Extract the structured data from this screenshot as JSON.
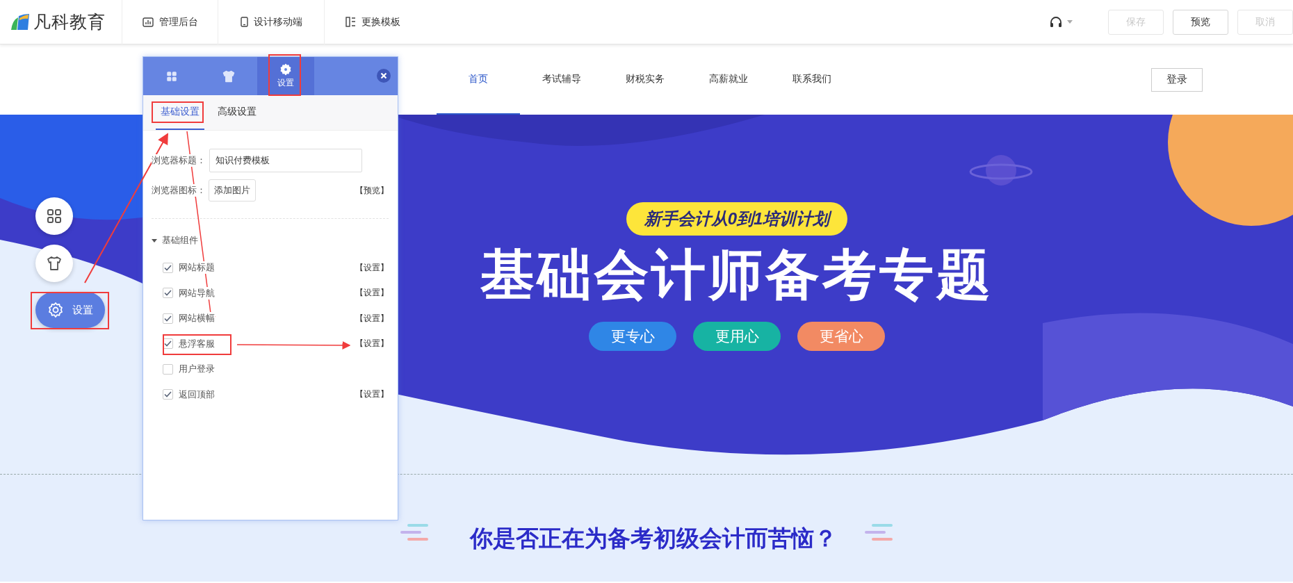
{
  "toolbar": {
    "logo_text": "凡科教育",
    "tabs": [
      {
        "kind": "chart",
        "label": "管理后台"
      },
      {
        "kind": "mobile",
        "label": "设计移动端"
      },
      {
        "kind": "template",
        "label": "更换模板"
      }
    ],
    "buttons": [
      {
        "label": "保存",
        "disabled": true
      },
      {
        "label": "预览",
        "disabled": false
      },
      {
        "label": "取消",
        "disabled": true
      }
    ]
  },
  "site": {
    "nav": [
      {
        "label": "首页",
        "selected": true
      },
      {
        "label": "考试辅导",
        "selected": false
      },
      {
        "label": "财税实务",
        "selected": false
      },
      {
        "label": "高薪就业",
        "selected": false
      },
      {
        "label": "联系我们",
        "selected": false
      }
    ],
    "login": "登录",
    "hero": {
      "tagline": "新手会计从0到1培训计划",
      "title": "基础会计师备考专题",
      "pills": [
        {
          "label": "更专心",
          "color": "#2f86e6"
        },
        {
          "label": "更用心",
          "color": "#17b3a3"
        },
        {
          "label": "更省心",
          "color": "#f28a63"
        }
      ]
    },
    "section_heading": "你是否正在为备考初级会计而苦恼？"
  },
  "side_buttons": [
    {
      "kind": "components",
      "selected": false
    },
    {
      "kind": "theme",
      "selected": false
    },
    {
      "kind": "settings",
      "label": "设置",
      "selected": true
    }
  ],
  "panel": {
    "tabs": [
      {
        "kind": "components",
        "selected": false
      },
      {
        "kind": "theme",
        "selected": false
      },
      {
        "kind": "settings",
        "label": "设置",
        "selected": true
      }
    ],
    "subtabs": [
      {
        "label": "基础设置",
        "selected": true
      },
      {
        "label": "高级设置",
        "selected": false
      }
    ],
    "browser_title": {
      "label": "浏览器标题：",
      "value": "知识付费模板"
    },
    "browser_icon": {
      "label": "浏览器图标：",
      "button": "添加图片",
      "link": "【预览】"
    },
    "group": {
      "label": "基础组件",
      "expanded": true,
      "items": [
        {
          "label": "网站标题",
          "checked": true,
          "action": "【设置】"
        },
        {
          "label": "网站导航",
          "checked": true,
          "action": "【设置】"
        },
        {
          "label": "网站横幅",
          "checked": true,
          "action": "【设置】"
        },
        {
          "label": "悬浮客服",
          "checked": true,
          "action": "【设置】"
        },
        {
          "label": "用户登录",
          "checked": false
        },
        {
          "label": "返回顶部",
          "checked": true,
          "action": "【设置】"
        }
      ]
    }
  }
}
